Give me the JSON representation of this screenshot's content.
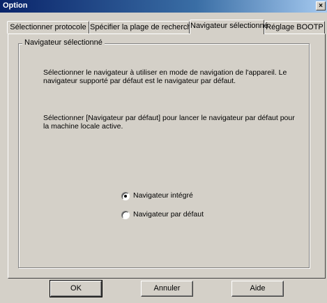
{
  "window": {
    "title": "Option",
    "close_glyph": "×"
  },
  "tabs": [
    {
      "label": "Sélectionner protocole",
      "active": false
    },
    {
      "label": "Spécifier la plage de recherche",
      "active": false
    },
    {
      "label": "Navigateur sélectionné",
      "active": true
    },
    {
      "label": "Réglage BOOTP",
      "active": false
    }
  ],
  "group": {
    "label": "Navigateur sélectionné",
    "paragraph1": "Sélectionner le navigateur à utiliser en mode de navigation de l'appareil. Le navigateur supporté par défaut est le navigateur par défaut.",
    "paragraph2": "Sélectionner [Navigateur par défaut] pour lancer le navigateur par défaut pour la machine locale active.",
    "radios": [
      {
        "label": "Navigateur intégré",
        "checked": true
      },
      {
        "label": "Navigateur par défaut",
        "checked": false
      }
    ]
  },
  "buttons": {
    "ok": "OK",
    "cancel": "Annuler",
    "help": "Aide"
  }
}
